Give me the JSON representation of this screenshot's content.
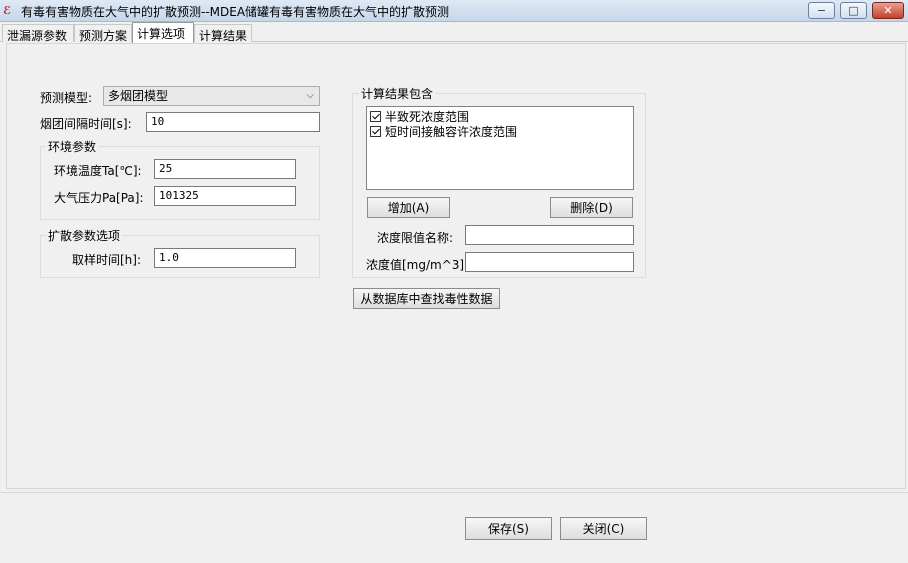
{
  "window": {
    "title": "有毒有害物质在大气中的扩散预测--MDEA储罐有毒有害物质在大气中的扩散预测",
    "minimize": "−",
    "maximize": "□",
    "close": "✕"
  },
  "tabs": [
    "泄漏源参数",
    "预测方案",
    "计算选项",
    "计算结果"
  ],
  "form": {
    "model_label": "预测模型:",
    "model_value": "多烟团模型",
    "interval_label": "烟团间隔时间[s]:",
    "interval_value": "10",
    "env_group": {
      "title": "环境参数",
      "temp_label": "环境温度Ta[℃]:",
      "temp_value": "25",
      "pressure_label": "大气压力Pa[Pa]:",
      "pressure_value": "101325"
    },
    "diffusion_group": {
      "title": "扩散参数选项",
      "sample_label": "取样时间[h]:",
      "sample_value": "1.0"
    }
  },
  "results": {
    "title": "计算结果包含",
    "items": [
      {
        "label": "半致死浓度范围",
        "checked": true
      },
      {
        "label": "短时间接触容许浓度范围",
        "checked": true
      }
    ],
    "add_button": "增加(A)",
    "delete_button": "删除(D)",
    "limit_name_label": "浓度限值名称:",
    "limit_name_value": "",
    "conc_label": "浓度值[mg/m^3]:",
    "conc_value": "",
    "db_button": "从数据库中查找毒性数据"
  },
  "footer": {
    "save": "保存(S)",
    "close": "关闭(C)"
  }
}
